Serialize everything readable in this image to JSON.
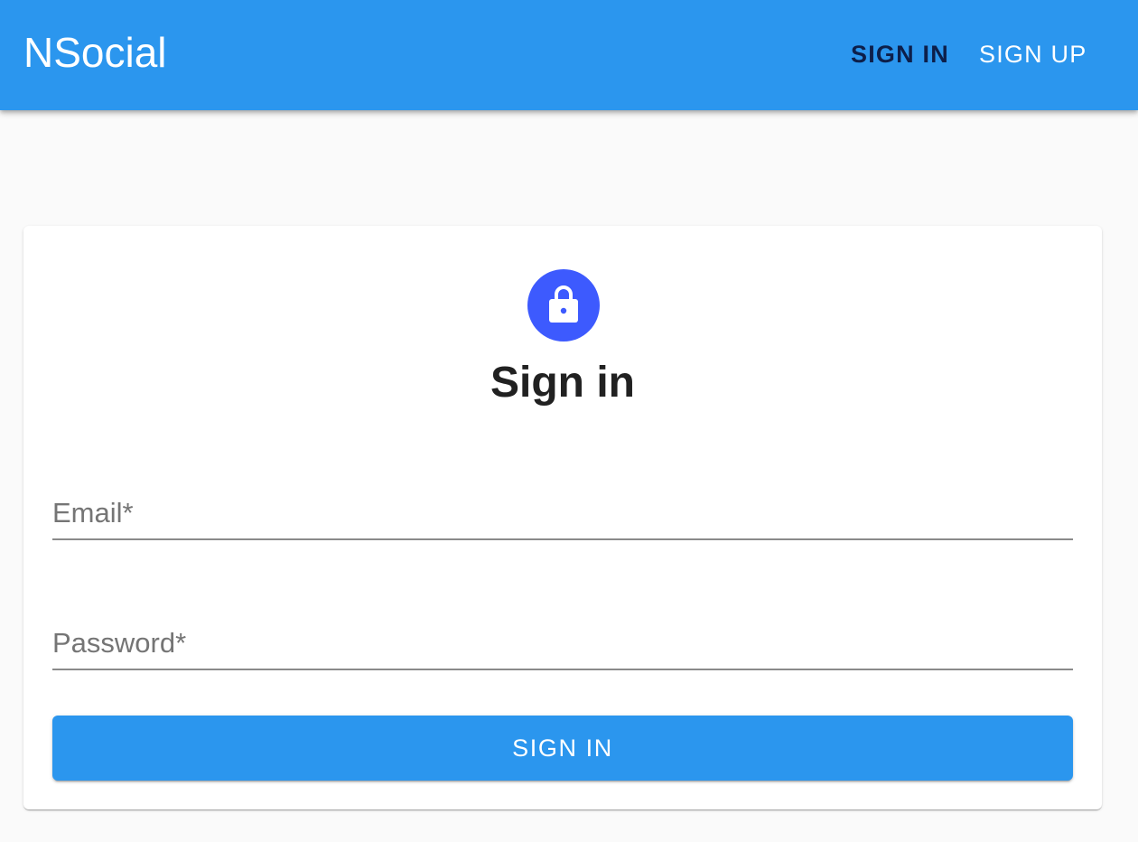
{
  "appbar": {
    "brand": "NSocial",
    "color": "#2b96ee",
    "nav": {
      "signin_label": "SIGN IN",
      "signup_label": "SIGN UP",
      "active": "signin"
    }
  },
  "form": {
    "icon": "lock-icon",
    "icon_color": "#3d5afe",
    "title": "Sign in",
    "email": {
      "label": "Email",
      "required_marker": "*",
      "value": ""
    },
    "password": {
      "label": "Password",
      "required_marker": "*",
      "value": ""
    },
    "submit_label": "SIGN IN"
  }
}
